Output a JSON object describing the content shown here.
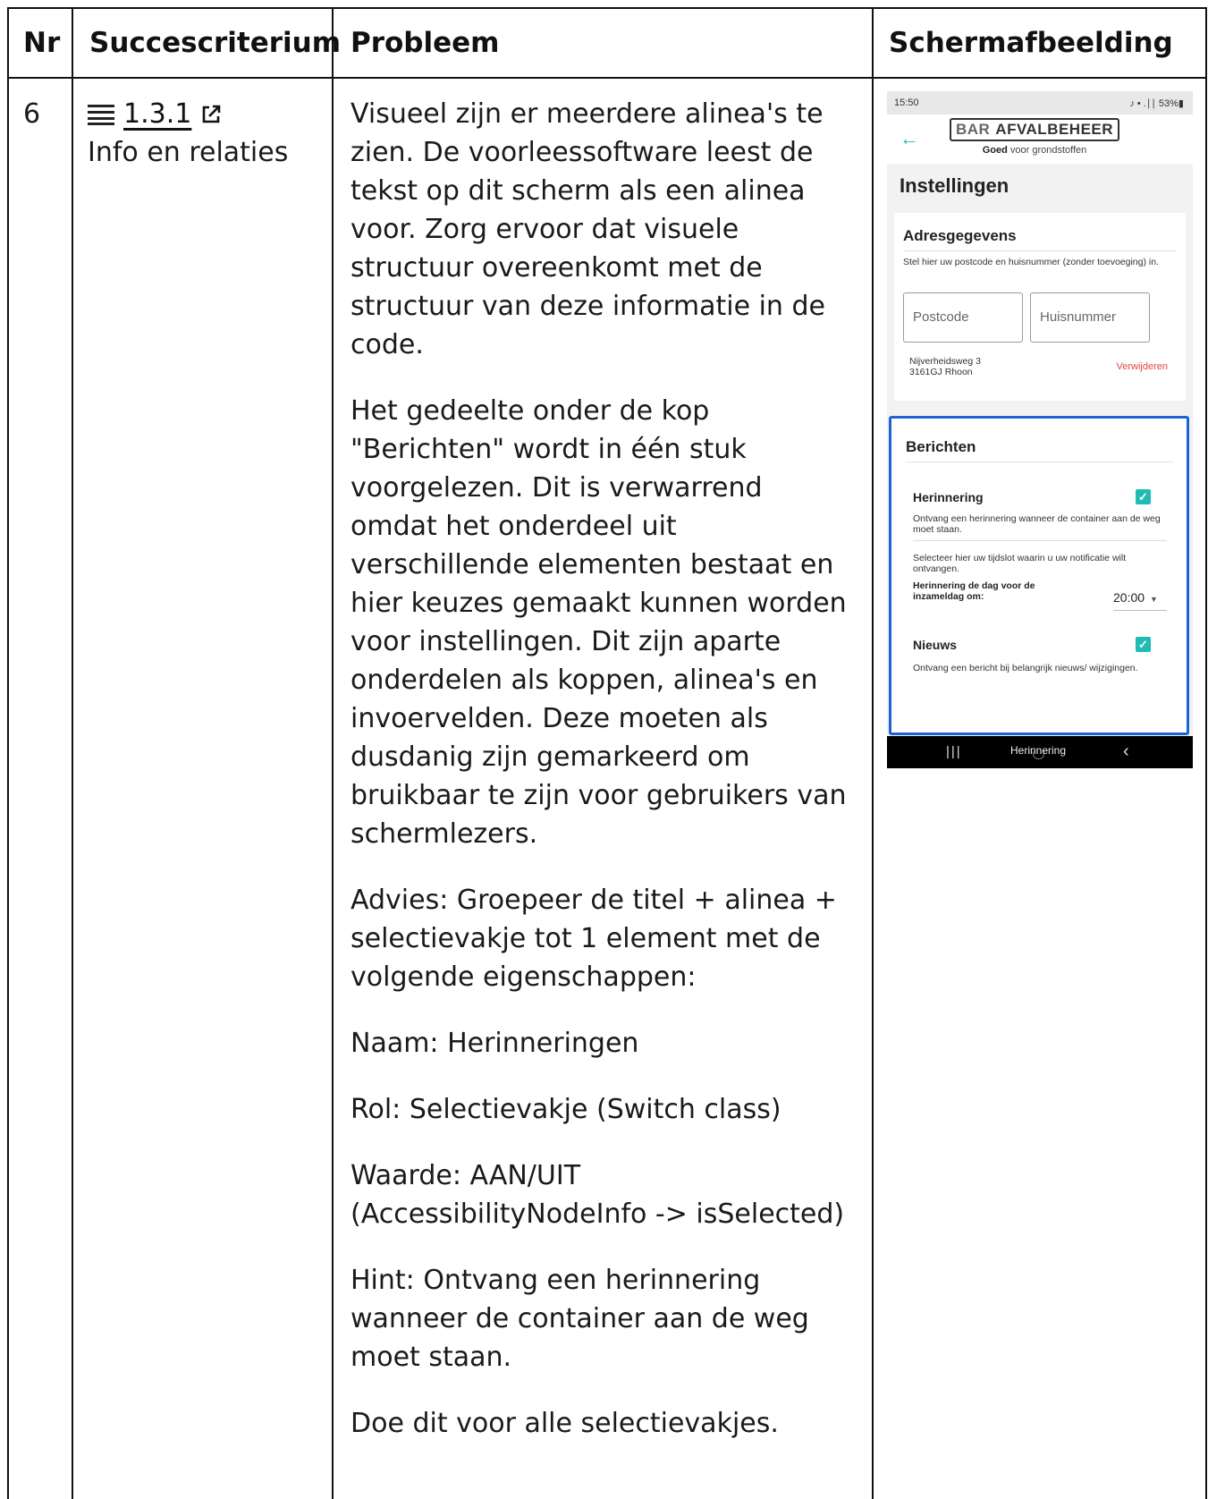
{
  "headers": {
    "nr": "Nr",
    "criterion": "Succescriterium",
    "problem": "Probleem",
    "screenshot": "Schermafbeelding"
  },
  "row": {
    "nr": "6",
    "criterion_number": "1.3.1",
    "criterion_name": "Info en relaties",
    "criterion_icon": "list-icon",
    "link_icon": "external-link-icon",
    "paragraphs": [
      "Visueel zijn er meerdere alinea's te zien. De voorleessoftware leest de tekst op dit scherm als een alinea voor. Zorg ervoor dat visuele structuur overeenkomt met de structuur van deze informatie in de code.",
      "Het gedeelte onder de kop \"Berichten\" wordt in één stuk voorgelezen. Dit is verwarrend omdat het onderdeel uit verschillende elementen bestaat en hier keuzes gemaakt kunnen worden voor instellingen. Dit zijn aparte onderdelen als koppen, alinea's en invoervelden. Deze moeten als dusdanig zijn gemarkeerd om bruikbaar te zijn voor gebruikers van schermlezers.",
      "Advies: Groepeer de titel + alinea + selectievakje tot 1 element met de volgende eigenschappen:",
      "Naam: Herinneringen",
      "Rol: Selectievakje (Switch class)",
      "Waarde: AAN/UIT (AccessibilityNodeInfo -> isSelected)",
      "Hint: Ontvang een herinnering wanneer de container aan de weg moet staan.",
      "Doe dit voor alle selectievakjes."
    ]
  },
  "phone": {
    "status_time": "15:50",
    "status_right": "♪ • .∣∣ 53%▮",
    "logo_bar": "BAR",
    "logo_name": "AFVALBEHEER",
    "logo_tag_bold": "Goed",
    "logo_tag_rest": " voor grondstoffen",
    "title": "Instellingen",
    "address_card": {
      "heading": "Adresgegevens",
      "intro": "Stel hier uw postcode en huisnummer (zonder toevoeging) in.",
      "postcode_placeholder": "Postcode",
      "huisnummer_placeholder": "Huisnummer",
      "address_line1": "Nijverheidsweg 3",
      "address_line2": "3161GJ Rhoon",
      "remove": "Verwijderen"
    },
    "messages_card": {
      "heading": "Berichten",
      "reminder_title": "Herinnering",
      "reminder_checked": true,
      "reminder_desc": "Ontvang een herinnering wanneer de container aan de weg moet staan.",
      "timeslot_desc": "Selecteer hier uw tijdslot waarin u uw notificatie wilt ontvangen.",
      "timeslot_label": "Herinnering de dag voor de inzameldag om:",
      "timeslot_value": "20:00",
      "news_title": "Nieuws",
      "news_checked": true,
      "news_desc": "Ontvang een bericht bij belangrijk nieuws/ wijzigingen."
    },
    "nav_label": "Herinnering",
    "accent_color": "#1fbcb4",
    "focus_color": "#1d63d6",
    "remove_color": "#e04848"
  }
}
